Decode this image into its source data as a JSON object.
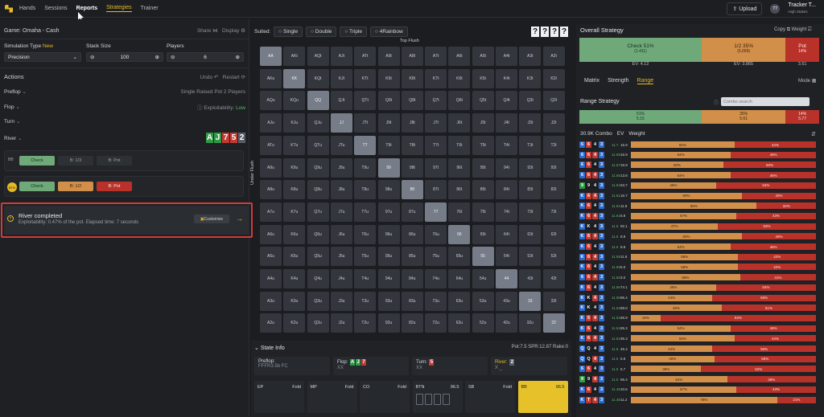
{
  "nav": {
    "hands": "Hands",
    "sessions": "Sessions",
    "reports": "Reports",
    "strategies": "Strategies",
    "trainer": "Trainer",
    "upload": "Upload",
    "user_initials": "TT",
    "user_name": "Tracker T...",
    "user_sub": "High Stakes"
  },
  "game": {
    "title": "Game: Omaha - Cash",
    "share": "Share",
    "display": "Display"
  },
  "settings": {
    "sim_type_label": "Simulation Type",
    "sim_new": "New",
    "stack_label": "Stack Size",
    "players_label": "Players",
    "sim_value": "Precision",
    "stack_value": "100",
    "players_value": "6"
  },
  "actions": {
    "title": "Actions",
    "undo": "Undo",
    "restart": "Restart",
    "preflop": "Preflop",
    "preflop_desc": "Single Raised Pot 2 Players",
    "flop": "Flop",
    "exploit": "Exploitability:",
    "exploit_val": "Low",
    "turn": "Turn",
    "river": "River",
    "river_cards": [
      "A",
      "J",
      "7",
      "5",
      "2"
    ]
  },
  "bb_row": {
    "seat": "BB",
    "check": "Check",
    "b1": "B: 1/3",
    "b2": "B: Pot"
  },
  "btn_row": {
    "seat": "BTN",
    "check": "Check",
    "b1": "B: 1/2",
    "b2": "B: Pot"
  },
  "river_done": {
    "title": "River completed",
    "text": "Exploitability: 0.47% of the pot. Elapsed time: 7 seconds",
    "customize": "Customize"
  },
  "matrix": {
    "suited": "Suited:",
    "single": "Single",
    "double": "Double",
    "triple": "Triple",
    "rainbow": "4Rainbow",
    "qmarks": [
      "?",
      "?",
      "?",
      "?"
    ],
    "top": "Top Flush",
    "side": "Under Flush",
    "rows": [
      [
        "AA",
        "AKt",
        "AQt",
        "AJt",
        "ATt",
        "A9t",
        "A8t",
        "A7t",
        "A6t",
        "A5t",
        "A4t",
        "A3t",
        "A2t"
      ],
      [
        "AKu",
        "KK",
        "KQt",
        "KJt",
        "KTt",
        "K9t",
        "K8t",
        "K7t",
        "K6t",
        "K5t",
        "K4t",
        "K3t",
        "K2t"
      ],
      [
        "AQu",
        "KQu",
        "QQ",
        "QJt",
        "QTt",
        "Q9t",
        "Q8t",
        "Q7t",
        "Q6t",
        "Q5t",
        "Q4t",
        "Q3t",
        "Q2t"
      ],
      [
        "AJu",
        "KJu",
        "QJu",
        "JJ",
        "JTt",
        "J9t",
        "J8t",
        "J7t",
        "J6t",
        "J5t",
        "J4t",
        "J3t",
        "J2t"
      ],
      [
        "ATu",
        "KTu",
        "QTu",
        "JTu",
        "TT",
        "T9t",
        "T8t",
        "T7t",
        "T6t",
        "T5t",
        "T4t",
        "T3t",
        "T2t"
      ],
      [
        "A9u",
        "K9u",
        "Q9u",
        "J9u",
        "T9u",
        "99",
        "98t",
        "97t",
        "96t",
        "95t",
        "94t",
        "93t",
        "92t"
      ],
      [
        "A8u",
        "K8u",
        "Q8u",
        "J8u",
        "T8u",
        "98u",
        "88",
        "87t",
        "86t",
        "85t",
        "84t",
        "83t",
        "82t"
      ],
      [
        "A7u",
        "K7u",
        "Q7u",
        "J7u",
        "T7u",
        "97u",
        "87u",
        "77",
        "76t",
        "75t",
        "74t",
        "73t",
        "72t"
      ],
      [
        "A6u",
        "K6u",
        "Q6u",
        "J6u",
        "T6u",
        "96u",
        "86u",
        "76u",
        "66",
        "65t",
        "64t",
        "63t",
        "62t"
      ],
      [
        "A5u",
        "K5u",
        "Q5u",
        "J5u",
        "T5u",
        "95u",
        "85u",
        "75u",
        "65u",
        "55",
        "54t",
        "53t",
        "52t"
      ],
      [
        "A4u",
        "K4u",
        "Q4u",
        "J4u",
        "T4u",
        "94u",
        "84u",
        "74u",
        "64u",
        "54u",
        "44",
        "43t",
        "42t"
      ],
      [
        "A3u",
        "K3u",
        "Q3u",
        "J3u",
        "T3u",
        "93u",
        "83u",
        "73u",
        "63u",
        "53u",
        "43u",
        "33",
        "32t"
      ],
      [
        "A2u",
        "K2u",
        "Q2u",
        "J2u",
        "T2u",
        "92u",
        "82u",
        "72u",
        "62u",
        "52u",
        "42u",
        "32u",
        "22"
      ]
    ]
  },
  "state": {
    "title": "State Info",
    "pot": "Pot:7.5",
    "spr": "SPR:12.87",
    "rake": "Rake:0",
    "preflop": "Preflop:",
    "preflop_val": "FFFR3.5b FC",
    "flop": "Flop:",
    "flop_val": "XX",
    "turn": "Turn:",
    "turn_val": "XX",
    "river": "River:",
    "river_val": "X _",
    "seats": [
      {
        "name": "EP",
        "act": "Fold"
      },
      {
        "name": "MP",
        "act": "Fold"
      },
      {
        "name": "CO",
        "act": "Fold"
      },
      {
        "name": "BTN",
        "act": "96.5"
      },
      {
        "name": "SB",
        "act": "Fold"
      },
      {
        "name": "BB",
        "act": "96.5"
      }
    ]
  },
  "overall": {
    "title": "Overall Strategy",
    "copy": "Copy",
    "weight": "Weight",
    "check_label": "Check 51%",
    "check_sub": "(1.411)",
    "check_ev": "EV: 4.12",
    "half_label": "1/2 35%",
    "half_sub": "(5,009)",
    "half_ev": "EV: 3.865",
    "pot_label": "Pot",
    "pot_pct": "14%",
    "pot_ev": "3.51"
  },
  "tabs": {
    "matrix": "Matrix",
    "strength": "Strength",
    "range": "Range",
    "mode": "Mode"
  },
  "range_strategy": {
    "title": "Range Strategy",
    "search": "Combo search",
    "g_pct": "51%",
    "g_val": "5.15",
    "o_pct": "35%",
    "o_val": "5.61",
    "r_pct": "14%",
    "r_val": "5.77"
  },
  "table": {
    "combo": "30.9K Combo",
    "ev": "EV",
    "weight": "Weight",
    "rows": [
      {
        "c": [
          "6",
          "6",
          "4",
          "3"
        ],
        "ev": "11.7",
        "w": "16.9",
        "o": 56,
        "ol": "56%",
        "rl": "44%"
      },
      {
        "c": [
          "6",
          "6",
          "4",
          "3"
        ],
        "ev": "11.68",
        "w": "16.9",
        "o": 54,
        "ol": "54%",
        "rl": "46%"
      },
      {
        "c": [
          "6",
          "6",
          "4",
          "3"
        ],
        "ev": "11.67",
        "w": "16.9",
        "o": 50,
        "ol": "50%",
        "rl": "50%"
      },
      {
        "c": [
          "6",
          "6",
          "4",
          "3"
        ],
        "ev": "11.65",
        "w": "13.8",
        "o": 54,
        "ol": "54%",
        "rl": "46%"
      },
      {
        "c": [
          "9",
          "9",
          "4",
          "3"
        ],
        "ev": "11.61",
        "w": "63.7",
        "o": 46,
        "ol": "46%",
        "rl": "54%"
      },
      {
        "c": [
          "K",
          "6",
          "4",
          "3"
        ],
        "ev": "11.61",
        "w": "16.7",
        "o": 60,
        "ol": "60%",
        "rl": "40%"
      },
      {
        "c": [
          "K",
          "6",
          "4",
          "3"
        ],
        "ev": "11.61",
        "w": "11.8",
        "o": 68,
        "ol": "68%",
        "rl": "32%"
      },
      {
        "c": [
          "K",
          "6",
          "4",
          "3"
        ],
        "ev": "11.61",
        "w": "6.8",
        "o": 57,
        "ol": "57%",
        "rl": "43%"
      },
      {
        "c": [
          "K",
          "K",
          "4",
          "3"
        ],
        "ev": "11.6",
        "w": "92.1",
        "o": 47,
        "ol": "47%",
        "rl": "53%"
      },
      {
        "c": [
          "K",
          "6",
          "4",
          "3"
        ],
        "ev": "11.6",
        "w": "8.8",
        "o": 60,
        "ol": "60%",
        "rl": "40%"
      },
      {
        "c": [
          "K",
          "6",
          "4",
          "3"
        ],
        "ev": "11.6",
        "w": "8.8",
        "o": 54,
        "ol": "54%",
        "rl": "46%"
      },
      {
        "c": [
          "K",
          "6",
          "4",
          "3"
        ],
        "ev": "11.59",
        "w": "11.8",
        "o": 58,
        "ol": "58%",
        "rl": "42%"
      },
      {
        "c": [
          "K",
          "6",
          "4",
          "3"
        ],
        "ev": "11.58",
        "w": "5.0",
        "o": 58,
        "ol": "58%",
        "rl": "42%"
      },
      {
        "c": [
          "6",
          "6",
          "4",
          "3"
        ],
        "ev": "11.56",
        "w": "3.0",
        "o": 59,
        "ol": "59%",
        "rl": "41%"
      },
      {
        "c": [
          "K",
          "6",
          "4",
          "3"
        ],
        "ev": "11.56",
        "w": "74.1",
        "o": 46,
        "ol": "46%",
        "rl": "54%"
      },
      {
        "c": [
          "K",
          "K",
          "4",
          "3"
        ],
        "ev": "11.56",
        "w": "96.4",
        "o": 44,
        "ol": "44%",
        "rl": "56%"
      },
      {
        "c": [
          "K",
          "K",
          "4",
          "3"
        ],
        "ev": "11.52",
        "w": "89.0",
        "o": 49,
        "ol": "49%",
        "rl": "51%"
      },
      {
        "c": [
          "K",
          "5",
          "4",
          "3"
        ],
        "ev": "11.51",
        "w": "86.9",
        "o": 16,
        "ol": "16%",
        "rl": "84%"
      },
      {
        "c": [
          "K",
          "6",
          "4",
          "3"
        ],
        "ev": "11.51",
        "w": "85.3",
        "o": 54,
        "ol": "54%",
        "rl": "46%"
      },
      {
        "c": [
          "K",
          "6",
          "4",
          "3"
        ],
        "ev": "11.51",
        "w": "95.3",
        "o": 56,
        "ol": "56%",
        "rl": "44%"
      },
      {
        "c": [
          "Q",
          "Q",
          "4",
          "3"
        ],
        "ev": "11.5",
        "w": "45.4",
        "o": 44,
        "ol": "44%",
        "rl": "56%"
      },
      {
        "c": [
          "Q",
          "Q",
          "4",
          "3"
        ],
        "ev": "11.5",
        "w": "6.8",
        "o": 45,
        "ol": "45%",
        "rl": "55%"
      },
      {
        "c": [
          "6",
          "6",
          "4",
          "3"
        ],
        "ev": "11.5",
        "w": "5.7",
        "o": 38,
        "ol": "38%",
        "rl": "62%"
      },
      {
        "c": [
          "9",
          "9",
          "4",
          "3"
        ],
        "ev": "11.5",
        "w": "95.4",
        "o": 52,
        "ol": "52%",
        "rl": "48%"
      },
      {
        "c": [
          "K",
          "6",
          "4",
          "3"
        ],
        "ev": "11.48",
        "w": "10.6",
        "o": 57,
        "ol": "57%",
        "rl": "43%"
      },
      {
        "c": [
          "K",
          "T",
          "4",
          "3"
        ],
        "ev": "11.48",
        "w": "11.2",
        "o": 79,
        "ol": "79%",
        "rl": "21%"
      }
    ]
  },
  "colors": {
    "accent": "#e6b922",
    "check": "#6fa97a",
    "half": "#d18f4a",
    "pot": "#b8322a",
    "highlight": "#e04040"
  }
}
